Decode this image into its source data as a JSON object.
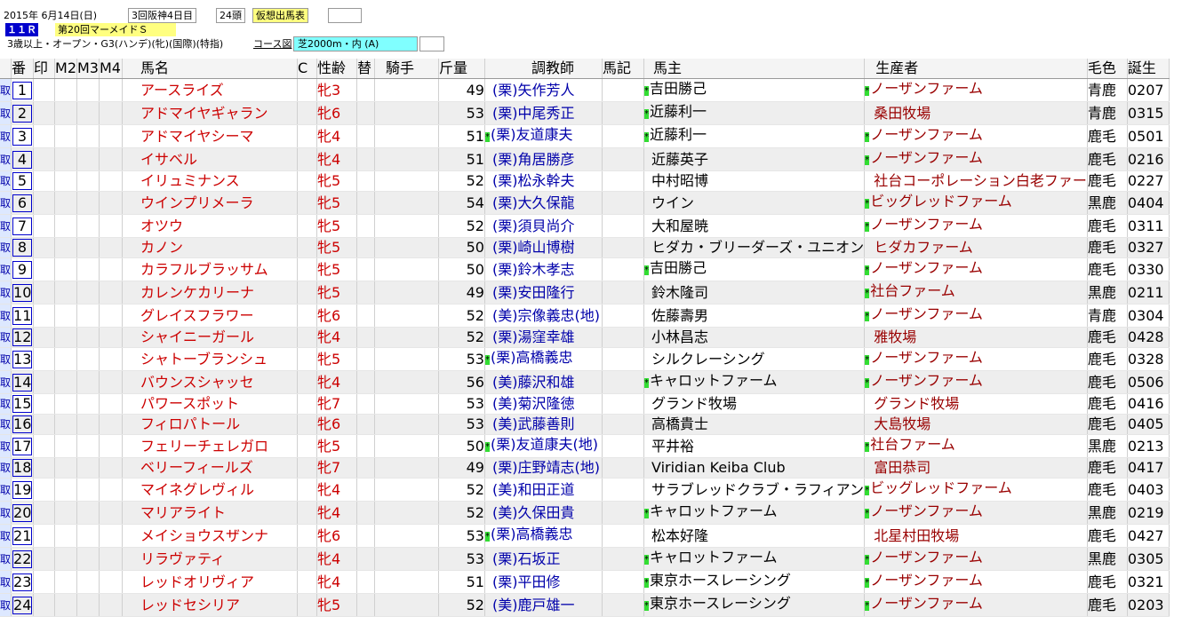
{
  "header": {
    "date": "2015年 6月14日(日)",
    "meeting": "3回阪神4日目",
    "runners": "24頭",
    "mode_label": "仮想出馬表",
    "race_no": "１１Ｒ",
    "race_name": "第20回マーメイドＳ",
    "conditions": "3歳以上・オープン・G3(ハンデ)(牝)(国際)(特指)",
    "course_label": "コース図",
    "course": "芝2000m・内 (A)"
  },
  "columns": [
    "番",
    "印",
    "M2",
    "M3",
    "M4",
    "馬名",
    "C",
    "性齢",
    "替",
    "騎手",
    "斤量",
    "調教師",
    "馬記",
    "馬主",
    "生産者",
    "毛色",
    "誕生"
  ],
  "side_label": "取",
  "rows": [
    {
      "no": "1",
      "name": "アースライズ",
      "sex": "牝3",
      "weight": "49",
      "trainer": "(栗)矢作芳人",
      "tmark": "",
      "owner": "吉田勝己",
      "omark": "*",
      "breeder": "ノーザンファーム",
      "bmark": "*",
      "color": "青鹿",
      "birth": "0207"
    },
    {
      "no": "2",
      "name": "アドマイヤギャラン",
      "sex": "牝6",
      "weight": "53",
      "trainer": "(栗)中尾秀正",
      "tmark": "",
      "owner": "近藤利一",
      "omark": "*",
      "breeder": "桑田牧場",
      "bmark": "",
      "color": "青鹿",
      "birth": "0315"
    },
    {
      "no": "3",
      "name": "アドマイヤシーマ",
      "sex": "牝4",
      "weight": "51",
      "trainer": "(栗)友道康夫",
      "tmark": "*",
      "owner": "近藤利一",
      "omark": "*",
      "breeder": "ノーザンファーム",
      "bmark": "*",
      "color": "鹿毛",
      "birth": "0501"
    },
    {
      "no": "4",
      "name": "イサベル",
      "sex": "牝4",
      "weight": "51",
      "trainer": "(栗)角居勝彦",
      "tmark": "",
      "owner": "近藤英子",
      "omark": "",
      "breeder": "ノーザンファーム",
      "bmark": "*",
      "color": "鹿毛",
      "birth": "0216"
    },
    {
      "no": "5",
      "name": "イリュミナンス",
      "sex": "牝5",
      "weight": "52",
      "trainer": "(栗)松永幹夫",
      "tmark": "",
      "owner": "中村昭博",
      "omark": "",
      "breeder": "社台コーポレーション白老ファー",
      "bmark": "",
      "color": "鹿毛",
      "birth": "0227"
    },
    {
      "no": "6",
      "name": "ウインプリメーラ",
      "sex": "牝5",
      "weight": "54",
      "trainer": "(栗)大久保龍",
      "tmark": "",
      "owner": "ウイン",
      "omark": "",
      "breeder": "ビッグレッドファーム",
      "bmark": "*",
      "color": "黒鹿",
      "birth": "0404"
    },
    {
      "no": "7",
      "name": "オツウ",
      "sex": "牝5",
      "weight": "52",
      "trainer": "(栗)須貝尚介",
      "tmark": "",
      "owner": "大和屋暁",
      "omark": "",
      "breeder": "ノーザンファーム",
      "bmark": "*",
      "color": "鹿毛",
      "birth": "0311"
    },
    {
      "no": "8",
      "name": "カノン",
      "sex": "牝5",
      "weight": "50",
      "trainer": "(栗)崎山博樹",
      "tmark": "",
      "owner": "ヒダカ・ブリーダーズ・ユニオン",
      "omark": "",
      "breeder": "ヒダカファーム",
      "bmark": "",
      "color": "鹿毛",
      "birth": "0327"
    },
    {
      "no": "9",
      "name": "カラフルブラッサム",
      "sex": "牝5",
      "weight": "50",
      "trainer": "(栗)鈴木孝志",
      "tmark": "",
      "owner": "吉田勝己",
      "omark": "*",
      "breeder": "ノーザンファーム",
      "bmark": "*",
      "color": "鹿毛",
      "birth": "0330"
    },
    {
      "no": "10",
      "name": "カレンケカリーナ",
      "sex": "牝5",
      "weight": "49",
      "trainer": "(栗)安田隆行",
      "tmark": "",
      "owner": "鈴木隆司",
      "omark": "",
      "breeder": "社台ファーム",
      "bmark": "*",
      "color": "黒鹿",
      "birth": "0211"
    },
    {
      "no": "11",
      "name": "グレイスフラワー",
      "sex": "牝6",
      "weight": "52",
      "trainer": "(美)宗像義忠(地)",
      "tmark": "",
      "owner": "佐藤壽男",
      "omark": "",
      "breeder": "ノーザンファーム",
      "bmark": "*",
      "color": "青鹿",
      "birth": "0304"
    },
    {
      "no": "12",
      "name": "シャイニーガール",
      "sex": "牝4",
      "weight": "52",
      "trainer": "(栗)湯窪幸雄",
      "tmark": "",
      "owner": "小林昌志",
      "omark": "",
      "breeder": "雅牧場",
      "bmark": "",
      "color": "鹿毛",
      "birth": "0428"
    },
    {
      "no": "13",
      "name": "シャトーブランシュ",
      "sex": "牝5",
      "weight": "53",
      "trainer": "(栗)高橋義忠",
      "tmark": "*",
      "owner": "シルクレーシング",
      "omark": "",
      "breeder": "ノーザンファーム",
      "bmark": "*",
      "color": "鹿毛",
      "birth": "0328"
    },
    {
      "no": "14",
      "name": "バウンスシャッセ",
      "sex": "牝4",
      "weight": "56",
      "trainer": "(美)藤沢和雄",
      "tmark": "",
      "owner": "キャロットファーム",
      "omark": "*",
      "breeder": "ノーザンファーム",
      "bmark": "*",
      "color": "鹿毛",
      "birth": "0506"
    },
    {
      "no": "15",
      "name": "パワースポット",
      "sex": "牝7",
      "weight": "53",
      "trainer": "(美)菊沢隆徳",
      "tmark": "",
      "owner": "グランド牧場",
      "omark": "",
      "breeder": "グランド牧場",
      "bmark": "",
      "color": "鹿毛",
      "birth": "0416"
    },
    {
      "no": "16",
      "name": "フィロパトール",
      "sex": "牝6",
      "weight": "53",
      "trainer": "(美)武藤善則",
      "tmark": "",
      "owner": "高橋貴士",
      "omark": "",
      "breeder": "大島牧場",
      "bmark": "",
      "color": "鹿毛",
      "birth": "0405"
    },
    {
      "no": "17",
      "name": "フェリーチェレガロ",
      "sex": "牝5",
      "weight": "50",
      "trainer": "(栗)友道康夫(地)",
      "tmark": "*",
      "owner": "平井裕",
      "omark": "",
      "breeder": "社台ファーム",
      "bmark": "*",
      "color": "黒鹿",
      "birth": "0213"
    },
    {
      "no": "18",
      "name": "ベリーフィールズ",
      "sex": "牝7",
      "weight": "49",
      "trainer": "(栗)庄野靖志(地)",
      "tmark": "",
      "owner": "Viridian Keiba Club",
      "omark": "",
      "breeder": "富田恭司",
      "bmark": "",
      "color": "鹿毛",
      "birth": "0417"
    },
    {
      "no": "19",
      "name": "マイネグレヴィル",
      "sex": "牝4",
      "weight": "52",
      "trainer": "(美)和田正道",
      "tmark": "",
      "owner": "サラブレッドクラブ・ラフィアン",
      "omark": "",
      "breeder": "ビッグレッドファーム",
      "bmark": "*",
      "color": "鹿毛",
      "birth": "0403"
    },
    {
      "no": "20",
      "name": "マリアライト",
      "sex": "牝4",
      "weight": "52",
      "trainer": "(美)久保田貴",
      "tmark": "",
      "owner": "キャロットファーム",
      "omark": "*",
      "breeder": "ノーザンファーム",
      "bmark": "*",
      "color": "黒鹿",
      "birth": "0219"
    },
    {
      "no": "21",
      "name": "メイショウスザンナ",
      "sex": "牝6",
      "weight": "53",
      "trainer": "(栗)高橋義忠",
      "tmark": "*",
      "owner": "松本好隆",
      "omark": "",
      "breeder": "北星村田牧場",
      "bmark": "",
      "color": "鹿毛",
      "birth": "0427"
    },
    {
      "no": "22",
      "name": "リラヴァティ",
      "sex": "牝4",
      "weight": "53",
      "trainer": "(栗)石坂正",
      "tmark": "",
      "owner": "キャロットファーム",
      "omark": "*",
      "breeder": "ノーザンファーム",
      "bmark": "*",
      "color": "黒鹿",
      "birth": "0305"
    },
    {
      "no": "23",
      "name": "レッドオリヴィア",
      "sex": "牝4",
      "weight": "51",
      "trainer": "(栗)平田修",
      "tmark": "",
      "owner": "東京ホースレーシング",
      "omark": "*",
      "breeder": "ノーザンファーム",
      "bmark": "*",
      "color": "鹿毛",
      "birth": "0321"
    },
    {
      "no": "24",
      "name": "レッドセシリア",
      "sex": "牝5",
      "weight": "52",
      "trainer": "(美)鹿戸雄一",
      "tmark": "",
      "owner": "東京ホースレーシング",
      "omark": "*",
      "breeder": "ノーザンファーム",
      "bmark": "*",
      "color": "鹿毛",
      "birth": "0203"
    }
  ]
}
